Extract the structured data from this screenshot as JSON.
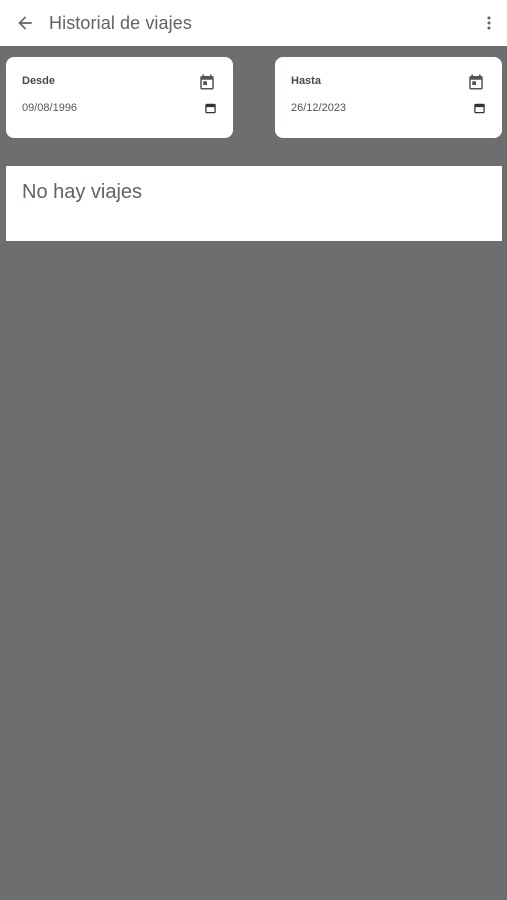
{
  "appbar": {
    "back_icon": "arrow-back-icon",
    "title": "Historial de viajes",
    "more_icon": "more-vert-icon"
  },
  "filters": {
    "from": {
      "label": "Desde",
      "value": "09/08/1996",
      "icon": "calendar-icon"
    },
    "to": {
      "label": "Hasta",
      "value": "26/12/2023",
      "icon": "calendar-icon"
    }
  },
  "trips": {
    "empty_message": "No hay viajes"
  },
  "colors": {
    "background": "#6d6e70",
    "surface": "#ffffff",
    "text_secondary": "#5f6368"
  }
}
